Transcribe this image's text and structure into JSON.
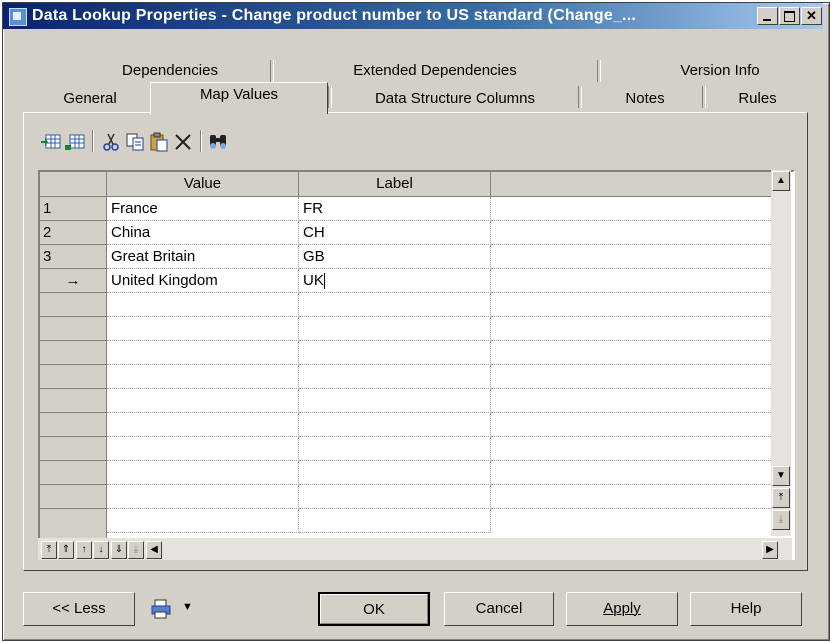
{
  "window": {
    "title": "Data Lookup Properties - Change product number to US standard (Change_..."
  },
  "tabs_back": [
    "Dependencies",
    "Extended Dependencies",
    "Version Info"
  ],
  "tabs_front": [
    "General",
    "Map Values",
    "Data Structure Columns",
    "Notes",
    "Rules"
  ],
  "active_tab": "Map Values",
  "toolbar": {
    "icons": [
      "insert-row-icon",
      "add-row-icon",
      "cut-icon",
      "copy-icon",
      "paste-icon",
      "delete-icon",
      "find-icon"
    ]
  },
  "grid": {
    "columns": [
      "Value",
      "Label"
    ],
    "rows": [
      {
        "num": "1",
        "value": "France",
        "label": "FR"
      },
      {
        "num": "2",
        "value": "China",
        "label": "CH"
      },
      {
        "num": "3",
        "value": "Great Britain",
        "label": "GB"
      },
      {
        "num": "→",
        "value": "United Kingdom",
        "label": "UK"
      }
    ]
  },
  "buttons": {
    "less": "<< Less",
    "ok": "OK",
    "cancel": "Cancel",
    "apply": "Apply",
    "help": "Help"
  }
}
